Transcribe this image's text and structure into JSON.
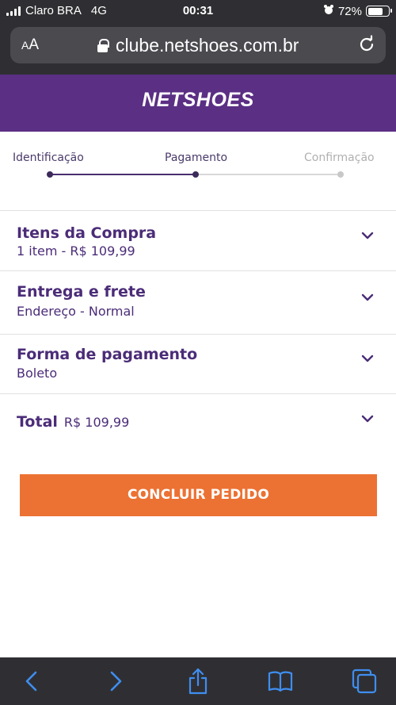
{
  "status_bar": {
    "carrier": "Claro BRA",
    "network": "4G",
    "time": "00:31",
    "battery_percent": "72%",
    "battery_level": 0.72
  },
  "browser": {
    "text_size_label": "AA",
    "url": "clube.netshoes.com.br"
  },
  "brand": {
    "logo_text": "NETSHOES",
    "color": "#5b2f84"
  },
  "steps": [
    {
      "label": "Identificação",
      "state": "done"
    },
    {
      "label": "Pagamento",
      "state": "current"
    },
    {
      "label": "Confirmação",
      "state": "pending"
    }
  ],
  "sections": {
    "items": {
      "title": "Itens da Compra",
      "subtitle": "1 item - R$ 109,99"
    },
    "delivery": {
      "title": "Entrega e frete",
      "subtitle": "Endereço - Normal"
    },
    "payment": {
      "title": "Forma de pagamento",
      "subtitle": "Boleto"
    },
    "total": {
      "label": "Total",
      "value": "R$ 109,99"
    }
  },
  "cta": {
    "label": "CONCLUIR PEDIDO",
    "color": "#ec7233"
  },
  "icons": [
    "signal-icon",
    "alarm-icon",
    "battery-icon",
    "lock-icon",
    "reload-icon",
    "chevron-down-icon",
    "back-icon",
    "forward-icon",
    "share-icon",
    "bookmarks-icon",
    "tabs-icon"
  ]
}
